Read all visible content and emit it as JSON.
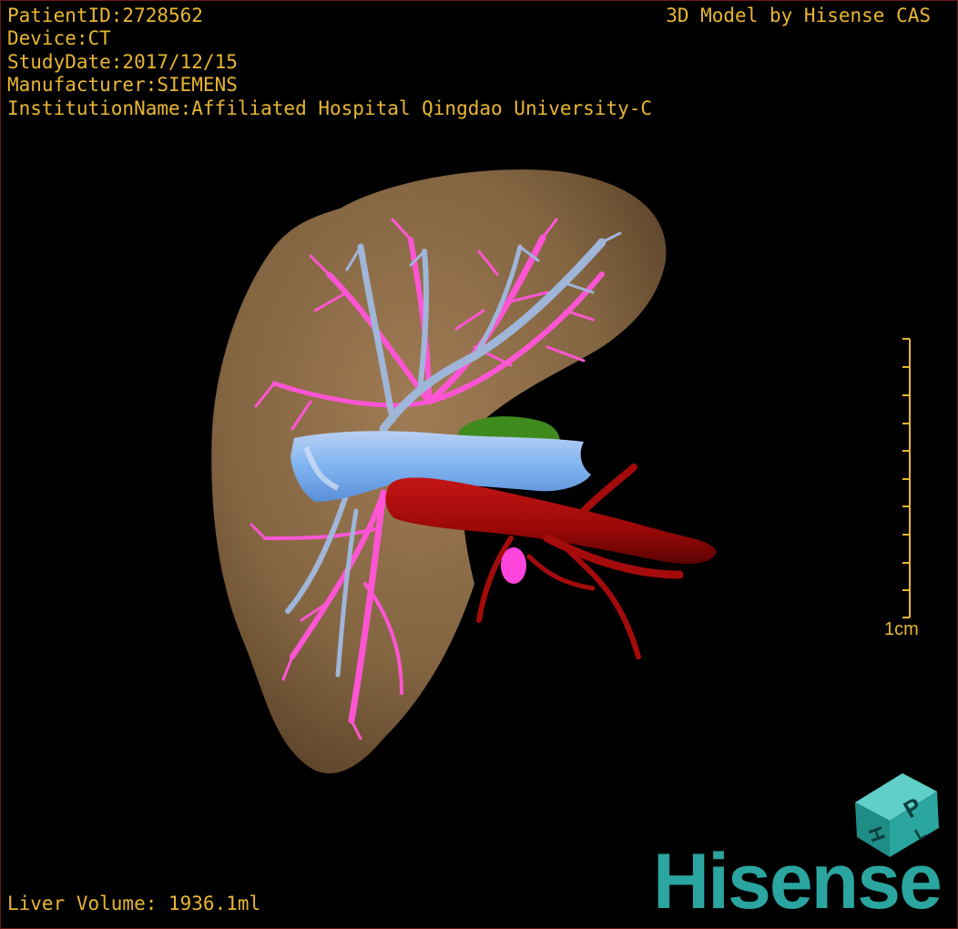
{
  "patient_info": {
    "patient_id": "PatientID:2728562",
    "device": "Device:CT",
    "study_date": "StudyDate:2017/12/15",
    "manufacturer": "Manufacturer:SIEMENS",
    "institution": "InstitutionName:Affiliated Hospital Qingdao University-C"
  },
  "brand_title": "3D Model by Hisense CAS",
  "liver_volume": "Liver Volume: 1936.1ml",
  "scale_bar": {
    "label": "1cm"
  },
  "orientation_cube": {
    "icon": "orientation-cube-icon",
    "faces": [
      "H",
      "P",
      "L"
    ]
  },
  "logo": {
    "text": "Hisense"
  },
  "colors": {
    "overlay_text": "#e9b632",
    "liver": "#8a6a45",
    "hepatic_vein": "#ff55d4",
    "portal_vein": "#9fb6d9",
    "vena_cava": "#7fb3f0",
    "aorta": "#b00a0a",
    "gallbladder": "#3f8a1c",
    "cube": "#2aa59f",
    "logo": "#2aa59f"
  }
}
